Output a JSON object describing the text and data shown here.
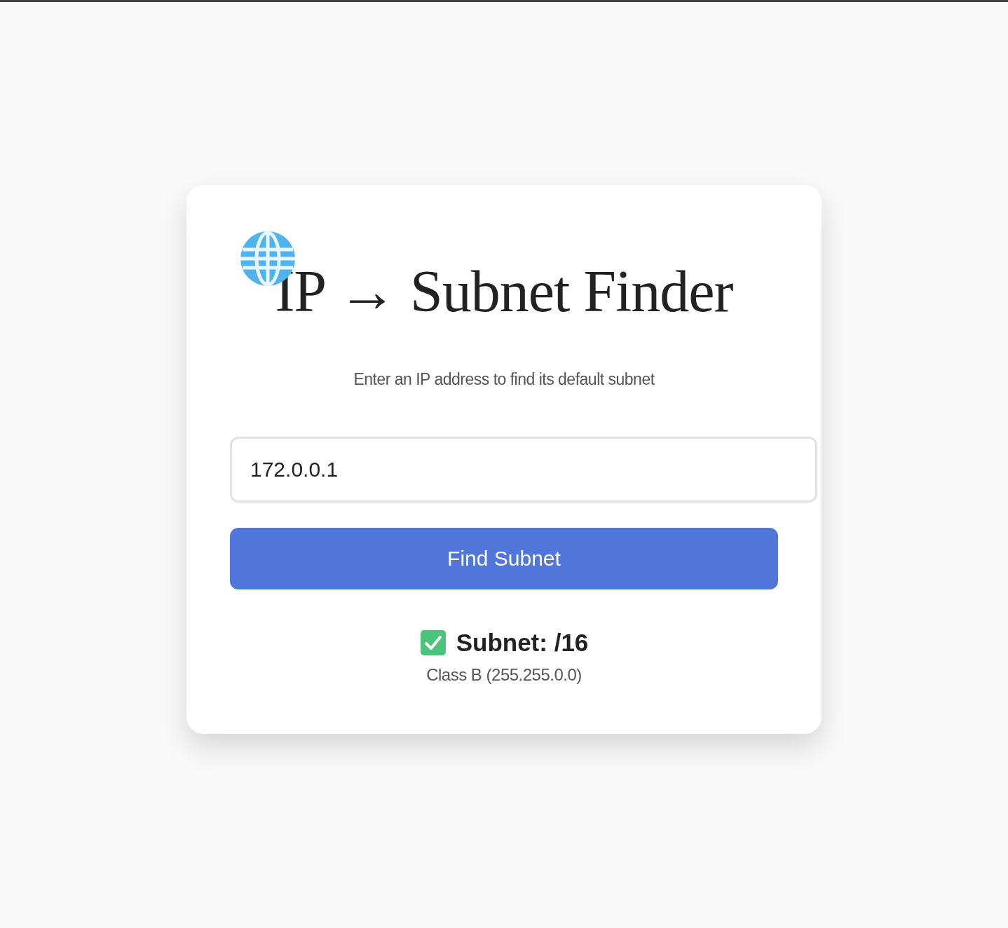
{
  "title": "IP → Subnet Finder",
  "subtitle": "Enter an IP address to find its default subnet",
  "ip_input": {
    "value": "172.0.0.1"
  },
  "button": {
    "label": "Find Subnet"
  },
  "result": {
    "heading": "Subnet: /16",
    "detail": "Class B (255.255.0.0)"
  }
}
